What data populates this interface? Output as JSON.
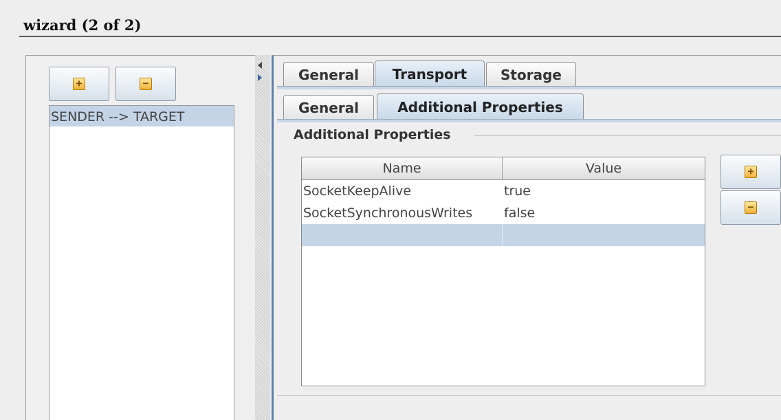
{
  "window": {
    "title": "wizard (2 of 2)"
  },
  "left_panel": {
    "add_icon": "plus-icon",
    "remove_icon": "minus-icon",
    "routes": [
      "SENDER --> TARGET"
    ]
  },
  "tabs": {
    "main": [
      {
        "label": "General",
        "selected": false
      },
      {
        "label": "Transport",
        "selected": true
      },
      {
        "label": "Storage",
        "selected": false
      }
    ],
    "sub": [
      {
        "label": "General",
        "selected": false
      },
      {
        "label": "Additional Properties",
        "selected": true
      }
    ]
  },
  "properties": {
    "group_title": "Additional Properties",
    "columns": [
      "Name",
      "Value"
    ],
    "rows": [
      {
        "name": "SocketKeepAlive",
        "value": "true"
      },
      {
        "name": "SocketSynchronousWrites",
        "value": "false"
      },
      {
        "name": "",
        "value": ""
      }
    ],
    "selected_row_index": 2
  },
  "colors": {
    "selection": "#c3d4e6",
    "tab_selected": "#c8d8e8",
    "icon_fill": "#f2b33a"
  }
}
